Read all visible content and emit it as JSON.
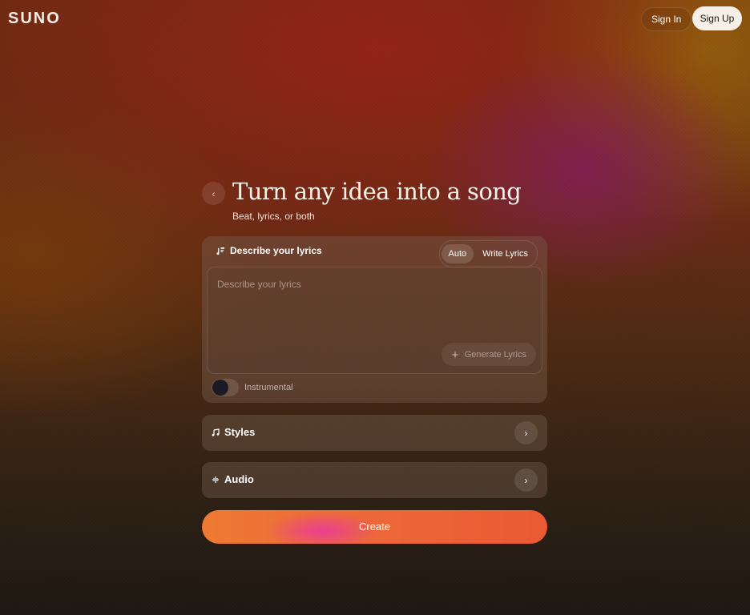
{
  "header": {
    "logo": "SUNO",
    "sign_in": "Sign In",
    "sign_up": "Sign Up"
  },
  "hero": {
    "back_icon": "‹",
    "title": "Turn any idea into a song",
    "subtitle": "Beat, lyrics, or both"
  },
  "lyrics_card": {
    "label": "Describe your lyrics",
    "modes": [
      "Auto",
      "Write Lyrics"
    ],
    "active_mode": "Auto",
    "placeholder": "Describe your lyrics",
    "generate_label": "Generate Lyrics",
    "instrumental_label": "Instrumental",
    "instrumental_on": false
  },
  "sections": {
    "styles_label": "Styles",
    "audio_label": "Audio",
    "chevron": "›"
  },
  "create_label": "Create",
  "colors": {
    "create_orange": "#ec6a3a",
    "create_pink": "#eb3c96",
    "signup_bg": "#f6f0e8"
  }
}
